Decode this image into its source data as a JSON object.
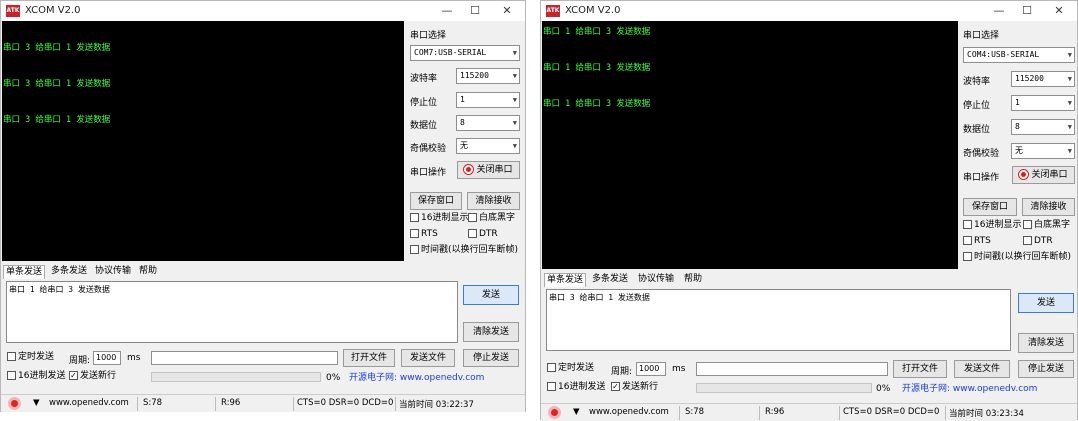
{
  "common": {
    "logo_text": "ATK",
    "title": "XCOM V2.0",
    "titlebar": {
      "minimize": "—",
      "maximize": "☐",
      "close": "✕"
    },
    "serial_select_label": "串口选择",
    "baud_label": "波特率",
    "baud_value": "115200",
    "stop_label": "停止位",
    "stop_value": "1",
    "data_label": "数据位",
    "data_value": "8",
    "parity_label": "奇偶校验",
    "parity_value": "无",
    "op_label": "串口操作",
    "close_port_button": "关闭串口",
    "save_window_button": "保存窗口",
    "clear_receive_button": "清除接收",
    "hex_display": "16进制显示",
    "white_bg": "白底黑字",
    "rts": "RTS",
    "dtr": "DTR",
    "timestamp": "时间戳(以换行回车断帧)",
    "tabs": [
      "单条发送",
      "多条发送",
      "协议传输",
      "帮助"
    ],
    "send_button": "发送",
    "clear_send_button": "清除发送",
    "timed_send": "定时发送",
    "period_label": "周期:",
    "period_value": "1000",
    "period_unit": "ms",
    "open_file_button": "打开文件",
    "send_file_button": "发送文件",
    "stop_send_button": "停止发送",
    "hex_send": "16进制发送",
    "send_newline": "发送新行",
    "progress_percent": "0%",
    "progress_value": 0,
    "website_link": "开源电子网: www.openedv.com",
    "status_web": "www.openedv.com",
    "status_s": "S:78",
    "status_r": "R:96",
    "status_lines": "CTS=0 DSR=0 DCD=0"
  },
  "left": {
    "com_port": "COM7:USB-SERIAL",
    "receive_lines": [
      "串口 3 给串口 1 发送数据",
      "串口 3 给串口 1 发送数据",
      "串口 3 给串口 1 发送数据"
    ],
    "send_text": "串口 1 给串口 3 发送数据",
    "status_time": "当前时间 03:22:37"
  },
  "right": {
    "com_port": "COM4:USB-SERIAL",
    "receive_lines": [
      "串口 1 给串口 3 发送数据",
      "串口 1 给串口 3 发送数据",
      "串口 1 给串口 3 发送数据"
    ],
    "send_text": "串口 3 给串口 1 发送数据",
    "status_time": "当前时间 03:23:34"
  },
  "colors": {
    "terminal_bg": "#000000",
    "terminal_text": "#3cff3c",
    "accent_red": "#e21b1b",
    "link_blue": "#1a3ee0"
  }
}
